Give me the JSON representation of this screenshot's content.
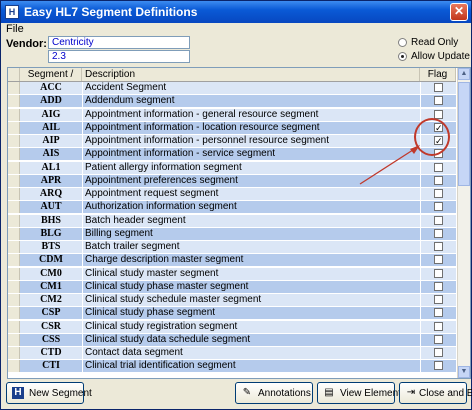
{
  "window": {
    "title": "Easy HL7 Segment Definitions",
    "icon": "hl7-app-icon",
    "close_glyph": "✕"
  },
  "menu": {
    "file": "File"
  },
  "vendor": {
    "label": "Vendor:",
    "name": "Centricity",
    "version": "2.3"
  },
  "options": {
    "read_only": "Read Only",
    "allow_update": "Allow Update",
    "selected": "allow_update"
  },
  "grid": {
    "columns": {
      "segment": "Segment",
      "segment_sort": "/",
      "description": "Description",
      "flag": "Flag"
    },
    "rows": [
      {
        "segment": "ACC",
        "description": "Accident Segment",
        "flag": false
      },
      {
        "segment": "ADD",
        "description": "Addendum segment",
        "flag": false
      },
      {
        "segment": "AIG",
        "description": "Appointment information - general resource segment",
        "flag": false
      },
      {
        "segment": "AIL",
        "description": "Appointment information - location resource segment",
        "flag": true
      },
      {
        "segment": "AIP",
        "description": "Appointment information - personnel resource segment",
        "flag": true
      },
      {
        "segment": "AIS",
        "description": "Appointment information - service segment",
        "flag": false
      },
      {
        "segment": "AL1",
        "description": "Patient allergy information segment",
        "flag": false
      },
      {
        "segment": "APR",
        "description": "Appointment preferences segment",
        "flag": false
      },
      {
        "segment": "ARQ",
        "description": "Appointment request segment",
        "flag": false
      },
      {
        "segment": "AUT",
        "description": "Authorization information segment",
        "flag": false
      },
      {
        "segment": "BHS",
        "description": "Batch header segment",
        "flag": false
      },
      {
        "segment": "BLG",
        "description": "Billing segment",
        "flag": false
      },
      {
        "segment": "BTS",
        "description": "Batch trailer segment",
        "flag": false
      },
      {
        "segment": "CDM",
        "description": "Charge description master segment",
        "flag": false
      },
      {
        "segment": "CM0",
        "description": "Clinical study master segment",
        "flag": false
      },
      {
        "segment": "CM1",
        "description": "Clinical study phase master segment",
        "flag": false
      },
      {
        "segment": "CM2",
        "description": "Clinical study schedule master segment",
        "flag": false
      },
      {
        "segment": "CSP",
        "description": "Clinical study phase segment",
        "flag": false
      },
      {
        "segment": "CSR",
        "description": "Clinical study registration segment",
        "flag": false
      },
      {
        "segment": "CSS",
        "description": "Clinical study data schedule segment",
        "flag": false
      },
      {
        "segment": "CTD",
        "description": "Contact data segment",
        "flag": false
      },
      {
        "segment": "CTI",
        "description": "Clinical trial identification segment",
        "flag": false
      }
    ]
  },
  "buttons": {
    "new_segment": {
      "label": "New Segment",
      "icon": "hl7-icon",
      "icon_text": "H"
    },
    "annotations": {
      "label": "Annotations",
      "icon": "pencil-icon",
      "icon_text": "✎"
    },
    "view_elements": {
      "label": "View Elements",
      "icon": "document-icon",
      "icon_text": "▤"
    },
    "close_exit": {
      "label": "Close and Exit",
      "icon": "exit-icon",
      "icon_text": "⇥"
    }
  },
  "annotation": {
    "color": "#c0392b"
  },
  "colors": {
    "title_bar": "#0a5ad6",
    "row_light": "#dbe6f6",
    "row_dark": "#b5cbec",
    "field_text": "#0000cc"
  }
}
